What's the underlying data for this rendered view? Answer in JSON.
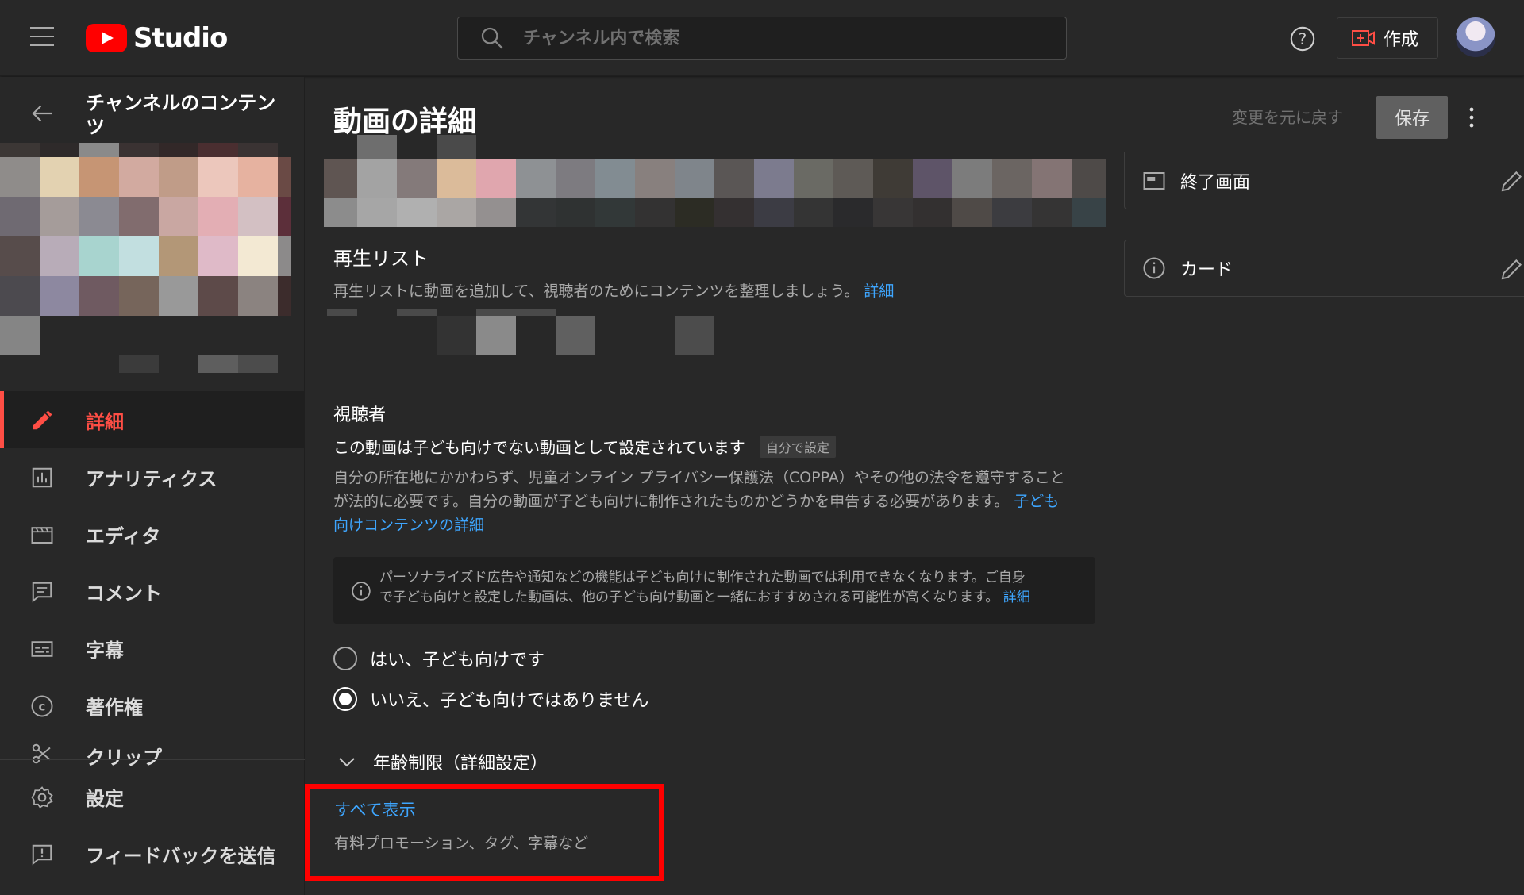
{
  "header": {
    "logo_text": "Studio",
    "search_placeholder": "チャンネル内で検索",
    "create_label": "作成"
  },
  "sidebar": {
    "channel_title": "チャンネルのコンテンツ",
    "items": [
      {
        "label": "詳細",
        "icon": "pencil-icon",
        "active": true
      },
      {
        "label": "アナリティクス",
        "icon": "analytics-icon"
      },
      {
        "label": "エディタ",
        "icon": "editor-icon"
      },
      {
        "label": "コメント",
        "icon": "comment-icon"
      },
      {
        "label": "字幕",
        "icon": "subtitles-icon"
      },
      {
        "label": "著作権",
        "icon": "copyright-icon"
      },
      {
        "label": "クリップ",
        "icon": "scissors-icon"
      }
    ],
    "bottom": [
      {
        "label": "設定",
        "icon": "gear-icon"
      },
      {
        "label": "フィードバックを送信",
        "icon": "feedback-icon"
      }
    ]
  },
  "main": {
    "title": "動画の詳細",
    "undo_label": "変更を元に戻す",
    "save_label": "保存",
    "playlist": {
      "title": "再生リスト",
      "desc": "再生リストに動画を追加して、視聴者のためにコンテンツを整理しましょう。",
      "link": "詳細"
    },
    "audience": {
      "title": "視聴者",
      "status": "この動画は子ども向けでない動画として設定されています",
      "badge": "自分で設定",
      "desc_line1": "自分の所在地にかかわらず、児童オンライン プライバシー保護法（COPPA）やその他の法令を遵守すること",
      "desc_line2": "が法的に必要です。自分の動画が子ども向けに制作されたものかどうかを申告する必要があります。",
      "link_part1": "子ども",
      "link_part2": "向けコンテンツの詳細",
      "info_line1": "パーソナライズド広告や通知などの機能は子ども向けに制作された動画では利用できなくなります。ご自身",
      "info_line2": "で子ども向けと設定した動画は、他の子ども向け動画と一緒におすすめされる可能性が高くなります。",
      "info_link": "詳細",
      "option_yes": "はい、子ども向けです",
      "option_no": "いいえ、子ども向けではありません",
      "selected": "no"
    },
    "age_restriction": "年齢制限（詳細設定）",
    "show_all": "すべて表示",
    "show_all_desc": "有料プロモーション、タグ、字幕など"
  },
  "right_panel": {
    "end_screen": "終了画面",
    "cards": "カード"
  },
  "colors": {
    "background": "#282828",
    "accent_red": "#ff4e45",
    "link_blue": "#3ea6ff",
    "highlight_red": "#ff0000"
  }
}
